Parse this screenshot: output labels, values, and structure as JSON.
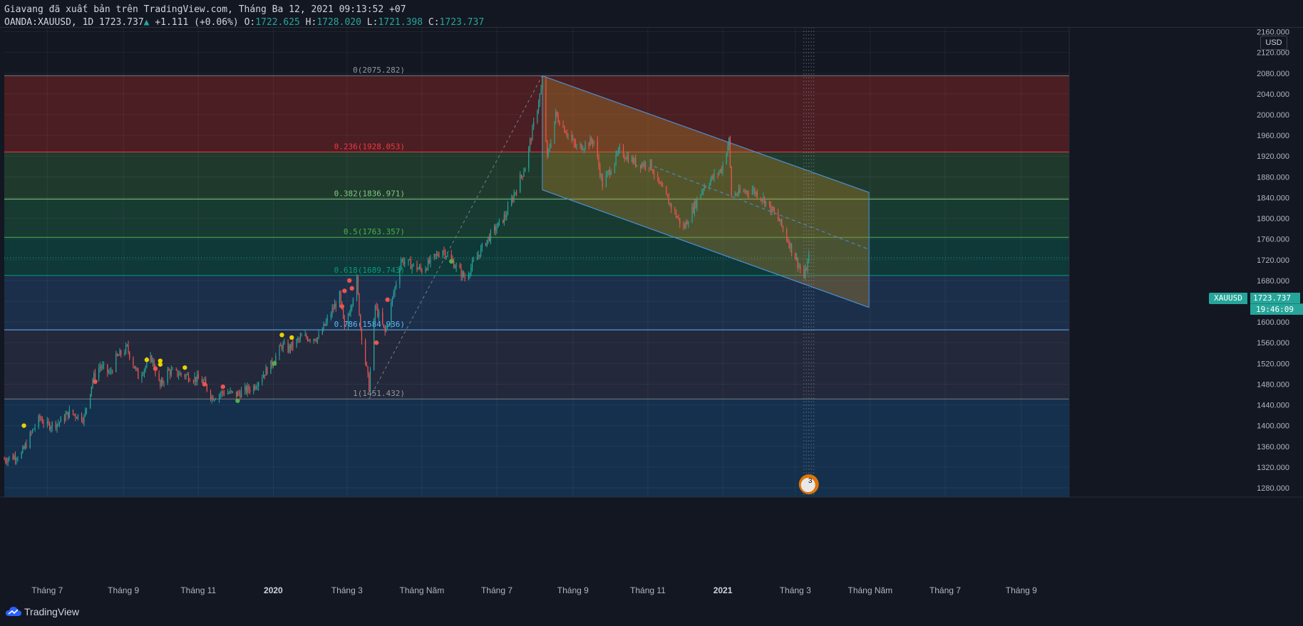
{
  "header": {
    "published": "Giavang đã xuất bản trên TradingView.com, Tháng Ba 12, 2021 09:13:52 +07",
    "symbol_line": "OANDA:XAUUSD, 1D 1723.737",
    "change_arrow": "▲",
    "change": "+1.111 (+0.06%)",
    "o_label": "O:",
    "o_value": "1722.625",
    "h_label": "H:",
    "h_value": "1728.020",
    "l_label": "L:",
    "l_value": "1721.398",
    "c_label": "C:",
    "c_value": "1723.737"
  },
  "currency": "USD",
  "price_tag": {
    "symbol": "XAUUSD",
    "value": "1723.737",
    "countdown": "19:46:09"
  },
  "footer": {
    "brand": "TradingView"
  },
  "event_badge": "3",
  "colors": {
    "up": "#26a69a",
    "down": "#ef5350",
    "background": "#131722",
    "channel_line": "#4a90d9",
    "channel_fill": "#b8862b"
  },
  "chart_data": {
    "type": "candlestick",
    "symbol": "OANDA:XAUUSD",
    "interval": "1D",
    "ylim": [
      1260,
      2160
    ],
    "y_ticks": [
      1280,
      1320,
      1360,
      1400,
      1440,
      1480,
      1520,
      1560,
      1600,
      1640,
      1680,
      1720,
      1760,
      1800,
      1840,
      1880,
      1920,
      1960,
      2000,
      2040,
      2080,
      2120,
      2160
    ],
    "y_tick_labels": [
      "1280.000",
      "1320.000",
      "1360.000",
      "1400.000",
      "1440.000",
      "1480.000",
      "1520.000",
      "1560.000",
      "1600.000",
      "1640.000",
      "1680.000",
      "1720.000",
      "1760.000",
      "1800.000",
      "1840.000",
      "1880.000",
      "1920.000",
      "1960.000",
      "2000.000",
      "2040.000",
      "2080.000",
      "2120.000",
      "2160.000"
    ],
    "x_ticks": [
      {
        "label": "Tháng 7",
        "date": "2019-07-01",
        "bold": false
      },
      {
        "label": "Tháng 9",
        "date": "2019-09-01",
        "bold": false
      },
      {
        "label": "Tháng 11",
        "date": "2019-11-01",
        "bold": false
      },
      {
        "label": "2020",
        "date": "2020-01-01",
        "bold": true
      },
      {
        "label": "Tháng 3",
        "date": "2020-03-01",
        "bold": false
      },
      {
        "label": "Tháng Năm",
        "date": "2020-05-01",
        "bold": false
      },
      {
        "label": "Tháng 7",
        "date": "2020-07-01",
        "bold": false
      },
      {
        "label": "Tháng 9",
        "date": "2020-09-01",
        "bold": false
      },
      {
        "label": "Tháng 11",
        "date": "2020-11-01",
        "bold": false
      },
      {
        "label": "2021",
        "date": "2021-01-01",
        "bold": true
      },
      {
        "label": "Tháng 3",
        "date": "2021-03-01",
        "bold": false
      },
      {
        "label": "Tháng Năm",
        "date": "2021-05-01",
        "bold": false
      },
      {
        "label": "Tháng 7",
        "date": "2021-07-01",
        "bold": false
      },
      {
        "label": "Tháng 9",
        "date": "2021-09-01",
        "bold": false
      }
    ],
    "last_price": 1723.737,
    "fibonacci": [
      {
        "level": "0",
        "price": 2075.282,
        "label": "0(2075.282)",
        "line": "#787b86",
        "text": "#9598a1",
        "fill": "#4a1e22"
      },
      {
        "level": "0.236",
        "price": 1928.053,
        "label": "0.236(1928.053)",
        "line": "#f23645",
        "text": "#f23645",
        "fill": "#1f3a2c"
      },
      {
        "level": "0.382",
        "price": 1836.971,
        "label": "0.382(1836.971)",
        "line": "#81c784",
        "text": "#81c784",
        "fill": "#173a31"
      },
      {
        "level": "0.5",
        "price": 1763.357,
        "label": "0.5(1763.357)",
        "line": "#4caf50",
        "text": "#4caf50",
        "fill": "#0f3838"
      },
      {
        "level": "0.618",
        "price": 1689.743,
        "label": "0.618(1689.743)",
        "line": "#089981",
        "text": "#089981",
        "fill": "#1b2f4a"
      },
      {
        "level": "0.786",
        "price": 1584.936,
        "label": "0.786(1584.936)",
        "line": "#64b5f6",
        "text": "#64b5f6",
        "fill": "#23283a"
      },
      {
        "level": "1",
        "price": 1451.432,
        "label": "1(1451.432)",
        "line": "#787b86",
        "text": "#9598a1",
        "fill": "#14304d"
      }
    ],
    "fib_swing": {
      "from": {
        "date": "2020-03-19",
        "price": 1451.432
      },
      "to": {
        "date": "2020-08-07",
        "price": 2075.282
      }
    },
    "channel": {
      "upper": {
        "from": {
          "date": "2020-08-07",
          "price": 2075
        },
        "to": {
          "date": "2021-04-30",
          "price": 1850
        }
      },
      "lower": {
        "from": {
          "date": "2020-08-07",
          "price": 1855
        },
        "to": {
          "date": "2021-04-30",
          "price": 1628
        }
      },
      "median": {
        "from": {
          "date": "2020-11-06",
          "price": 1900
        },
        "to": {
          "date": "2021-04-30",
          "price": 1740
        }
      }
    },
    "vertical_marker": {
      "date": "2021-03-12"
    },
    "trend_path": [
      {
        "date": "2019-05-27",
        "price": 1335
      },
      {
        "date": "2019-06-10",
        "price": 1345
      },
      {
        "date": "2019-06-20",
        "price": 1395
      },
      {
        "date": "2019-06-25",
        "price": 1415
      },
      {
        "date": "2019-07-01",
        "price": 1400
      },
      {
        "date": "2019-07-10",
        "price": 1405
      },
      {
        "date": "2019-07-19",
        "price": 1425
      },
      {
        "date": "2019-07-31",
        "price": 1415
      },
      {
        "date": "2019-08-07",
        "price": 1490
      },
      {
        "date": "2019-08-13",
        "price": 1515
      },
      {
        "date": "2019-08-21",
        "price": 1500
      },
      {
        "date": "2019-08-26",
        "price": 1530
      },
      {
        "date": "2019-09-04",
        "price": 1550
      },
      {
        "date": "2019-09-13",
        "price": 1495
      },
      {
        "date": "2019-09-24",
        "price": 1530
      },
      {
        "date": "2019-10-01",
        "price": 1475
      },
      {
        "date": "2019-10-07",
        "price": 1505
      },
      {
        "date": "2019-10-25",
        "price": 1495
      },
      {
        "date": "2019-11-05",
        "price": 1485
      },
      {
        "date": "2019-11-12",
        "price": 1455
      },
      {
        "date": "2019-11-22",
        "price": 1465
      },
      {
        "date": "2019-12-02",
        "price": 1460
      },
      {
        "date": "2019-12-16",
        "price": 1475
      },
      {
        "date": "2019-12-24",
        "price": 1500
      },
      {
        "date": "2019-12-31",
        "price": 1520
      },
      {
        "date": "2020-01-08",
        "price": 1555
      },
      {
        "date": "2020-01-13",
        "price": 1548
      },
      {
        "date": "2020-01-24",
        "price": 1570
      },
      {
        "date": "2020-02-07",
        "price": 1570
      },
      {
        "date": "2020-02-24",
        "price": 1650
      },
      {
        "date": "2020-02-28",
        "price": 1585
      },
      {
        "date": "2020-03-09",
        "price": 1680
      },
      {
        "date": "2020-03-12",
        "price": 1590
      },
      {
        "date": "2020-03-19",
        "price": 1475
      },
      {
        "date": "2020-03-24",
        "price": 1630
      },
      {
        "date": "2020-04-01",
        "price": 1580
      },
      {
        "date": "2020-04-14",
        "price": 1720
      },
      {
        "date": "2020-05-01",
        "price": 1700
      },
      {
        "date": "2020-05-18",
        "price": 1740
      },
      {
        "date": "2020-06-05",
        "price": 1685
      },
      {
        "date": "2020-06-22",
        "price": 1755
      },
      {
        "date": "2020-07-08",
        "price": 1805
      },
      {
        "date": "2020-07-24",
        "price": 1900
      },
      {
        "date": "2020-08-07",
        "price": 2060
      },
      {
        "date": "2020-08-11",
        "price": 1915
      },
      {
        "date": "2020-08-18",
        "price": 2000
      },
      {
        "date": "2020-09-04",
        "price": 1935
      },
      {
        "date": "2020-09-18",
        "price": 1950
      },
      {
        "date": "2020-09-25",
        "price": 1865
      },
      {
        "date": "2020-10-09",
        "price": 1930
      },
      {
        "date": "2020-10-23",
        "price": 1905
      },
      {
        "date": "2020-11-03",
        "price": 1905
      },
      {
        "date": "2020-11-09",
        "price": 1870
      },
      {
        "date": "2020-11-30",
        "price": 1780
      },
      {
        "date": "2020-12-16",
        "price": 1860
      },
      {
        "date": "2020-12-31",
        "price": 1895
      },
      {
        "date": "2021-01-06",
        "price": 1950
      },
      {
        "date": "2021-01-08",
        "price": 1845
      },
      {
        "date": "2021-01-25",
        "price": 1855
      },
      {
        "date": "2021-02-04",
        "price": 1835
      },
      {
        "date": "2021-02-16",
        "price": 1795
      },
      {
        "date": "2021-03-01",
        "price": 1725
      },
      {
        "date": "2021-03-08",
        "price": 1685
      },
      {
        "date": "2021-03-12",
        "price": 1723.737
      }
    ],
    "markers": [
      {
        "date": "2019-06-12",
        "price": 1400,
        "color": "#e6d300"
      },
      {
        "date": "2019-08-09",
        "price": 1485,
        "color": "#ef5350"
      },
      {
        "date": "2019-09-20",
        "price": 1527,
        "color": "#e6d300"
      },
      {
        "date": "2019-09-27",
        "price": 1510,
        "color": "#ef5350"
      },
      {
        "date": "2019-10-01",
        "price": 1525,
        "color": "#e6d300"
      },
      {
        "date": "2019-10-01",
        "price": 1518,
        "color": "#e6d300"
      },
      {
        "date": "2019-10-21",
        "price": 1512,
        "color": "#e6d300"
      },
      {
        "date": "2019-11-06",
        "price": 1480,
        "color": "#ef5350"
      },
      {
        "date": "2019-11-21",
        "price": 1475,
        "color": "#ef5350"
      },
      {
        "date": "2019-12-03",
        "price": 1448,
        "color": "#4caf50"
      },
      {
        "date": "2020-01-02",
        "price": 1520,
        "color": "#4caf50"
      },
      {
        "date": "2020-01-08",
        "price": 1575,
        "color": "#e6d300"
      },
      {
        "date": "2020-01-16",
        "price": 1570,
        "color": "#e6d300"
      },
      {
        "date": "2020-02-26",
        "price": 1630,
        "color": "#ef5350"
      },
      {
        "date": "2020-02-28",
        "price": 1660,
        "color": "#ef5350"
      },
      {
        "date": "2020-03-03",
        "price": 1680,
        "color": "#ef5350"
      },
      {
        "date": "2020-03-05",
        "price": 1665,
        "color": "#ef5350"
      },
      {
        "date": "2020-03-25",
        "price": 1560,
        "color": "#ef5350"
      },
      {
        "date": "2020-04-03",
        "price": 1643,
        "color": "#ef5350"
      },
      {
        "date": "2020-05-25",
        "price": 1717,
        "color": "#4caf50"
      }
    ]
  }
}
